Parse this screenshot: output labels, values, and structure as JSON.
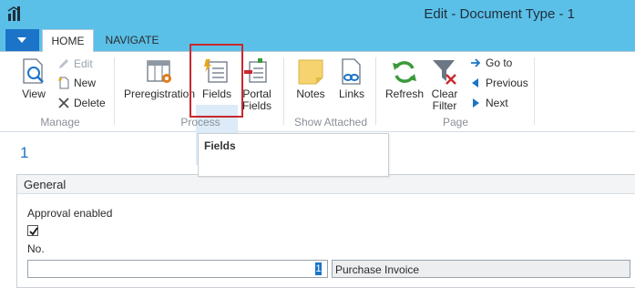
{
  "window": {
    "title": "Edit - Document Type - 1"
  },
  "tabs": [
    {
      "label": "HOME",
      "active": true
    },
    {
      "label": "NAVIGATE",
      "active": false
    }
  ],
  "ribbon": {
    "manage": {
      "group_label": "Manage",
      "view_label": "View",
      "edit_label": "Edit",
      "new_label": "New",
      "delete_label": "Delete"
    },
    "process": {
      "group_label": "Process",
      "preregistration_label": "Preregistration",
      "fields_label": "Fields",
      "portal_fields_label_1": "Portal",
      "portal_fields_label_2": "Fields"
    },
    "show_attached": {
      "group_label": "Show Attached",
      "notes_label": "Notes",
      "links_label": "Links"
    },
    "page": {
      "group_label": "Page",
      "refresh_label": "Refresh",
      "clear_filter_label_1": "Clear",
      "clear_filter_label_2": "Filter",
      "goto_label": "Go to",
      "previous_label": "Previous",
      "next_label": "Next"
    }
  },
  "tooltip": {
    "title": "Fields"
  },
  "record": {
    "title": "1"
  },
  "general": {
    "header": "General",
    "approval_enabled_label": "Approval enabled",
    "approval_enabled_checked": true,
    "no_label": "No.",
    "no_value": "",
    "no_caret_value": "1",
    "description_value": "Purchase Invoice"
  },
  "colors": {
    "titlebar": "#5bc0e8",
    "accent": "#1b74c7",
    "highlight": "#c8282e"
  }
}
